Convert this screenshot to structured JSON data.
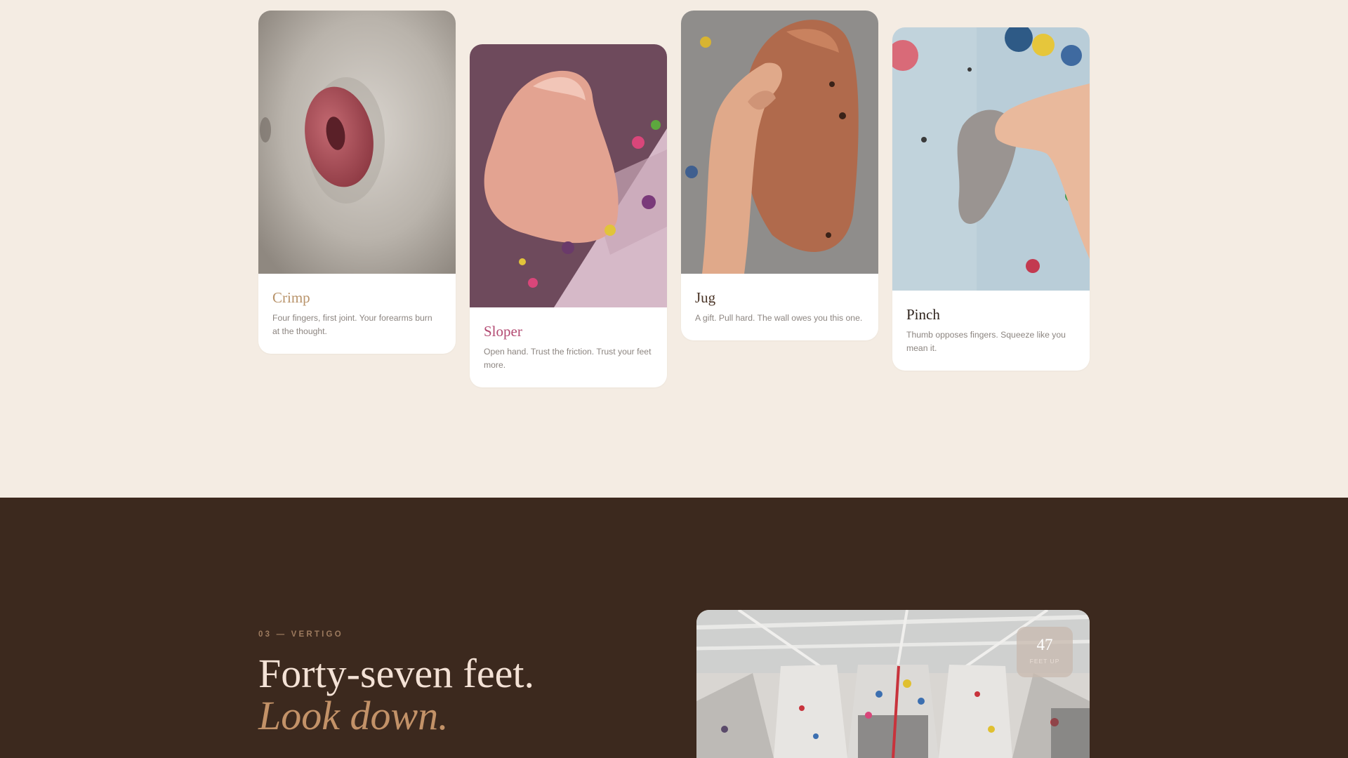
{
  "holds": [
    {
      "name": "Crimp",
      "description": "Four fingers, first joint. Your forearms burn at the thought.",
      "title_color": "#b8936a"
    },
    {
      "name": "Sloper",
      "description": "Open hand. Trust the friction. Trust your feet more.",
      "title_color": "#b34a72"
    },
    {
      "name": "Jug",
      "description": "A gift. Pull hard. The wall owes you this one.",
      "title_color": "#4a3426"
    },
    {
      "name": "Pinch",
      "description": "Thumb opposes fingers. Squeeze like you mean it.",
      "title_color": "#2e231c"
    }
  ],
  "vertigo": {
    "eyebrow": "03 — VERTIGO",
    "headline_line1": "Forty-seven feet.",
    "headline_line2": "Look down.",
    "badge_number": "47",
    "badge_label": "FEET UP"
  },
  "colors": {
    "cream_background": "#f4ece3",
    "dark_background": "#3c291e",
    "accent": "#c39268"
  }
}
